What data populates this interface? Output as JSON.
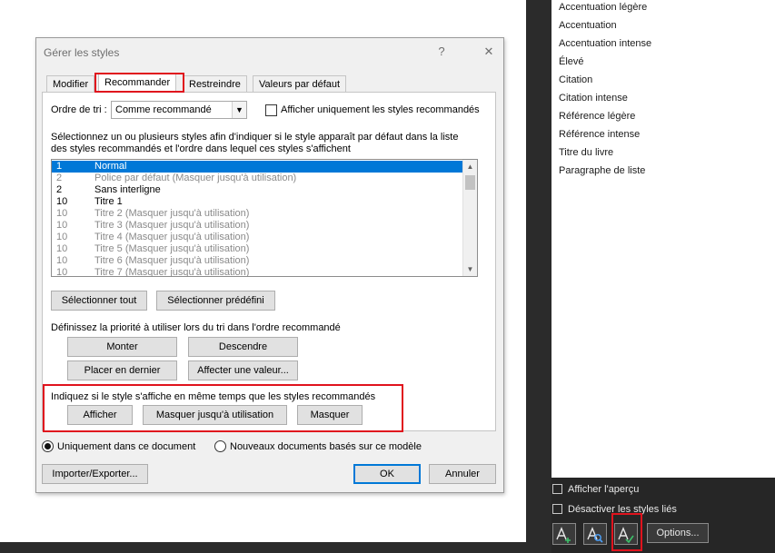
{
  "dialog": {
    "title": "Gérer les styles",
    "help": "?",
    "close": "✕",
    "tabs": [
      "Modifier",
      "Recommander",
      "Restreindre",
      "Valeurs par défaut"
    ],
    "sort_label": "Ordre de tri :",
    "sort_value": "Comme recommandé",
    "only_recommended_label": "Afficher uniquement les styles recommandés",
    "instructions_line1": "Sélectionnez un ou plusieurs styles afin d'indiquer si le style apparaît par défaut dans la liste",
    "instructions_line2": "des styles recommandés et l'ordre dans lequel ces styles s'affichent",
    "styles": [
      {
        "num": "1",
        "name": "Normal"
      },
      {
        "num": "2",
        "name": "Police par défaut  (Masquer jusqu'à utilisation)"
      },
      {
        "num": "2",
        "name": "Sans interligne"
      },
      {
        "num": "10",
        "name": "Titre 1"
      },
      {
        "num": "10",
        "name": "Titre 2  (Masquer jusqu'à utilisation)"
      },
      {
        "num": "10",
        "name": "Titre 3  (Masquer jusqu'à utilisation)"
      },
      {
        "num": "10",
        "name": "Titre 4  (Masquer jusqu'à utilisation)"
      },
      {
        "num": "10",
        "name": "Titre 5  (Masquer jusqu'à utilisation)"
      },
      {
        "num": "10",
        "name": "Titre 6  (Masquer jusqu'à utilisation)"
      },
      {
        "num": "10",
        "name": "Titre 7  (Masquer jusqu'à utilisation)"
      }
    ],
    "select_all": "Sélectionner tout",
    "select_builtin": "Sélectionner prédéfini",
    "priority_label": "Définissez la priorité à utiliser lors du tri dans l'ordre recommandé",
    "move_up": "Monter",
    "move_down": "Descendre",
    "make_last": "Placer en dernier",
    "assign_value": "Affecter une valeur...",
    "visibility_label": "Indiquez si le style s'affiche en même temps que les styles recommandés",
    "show": "Afficher",
    "hide_until_used": "Masquer jusqu'à utilisation",
    "hide": "Masquer",
    "radio_this_doc": "Uniquement dans ce document",
    "radio_new_docs": "Nouveaux documents basés sur ce modèle",
    "import_export": "Importer/Exporter...",
    "ok": "OK",
    "cancel": "Annuler"
  },
  "styles_pane": {
    "items": [
      "Accentuation légère",
      "Accentuation",
      "Accentuation intense",
      "Élevé",
      "Citation",
      "Citation intense",
      "Référence légère",
      "Référence intense",
      "Titre du livre",
      "Paragraphe de liste"
    ],
    "show_preview": "Afficher l'aperçu",
    "disable_linked": "Désactiver les styles liés",
    "options": "Options..."
  },
  "colors": {
    "highlight": "#e0131d",
    "selection": "#0078d7",
    "pane_bg": "#262626"
  }
}
